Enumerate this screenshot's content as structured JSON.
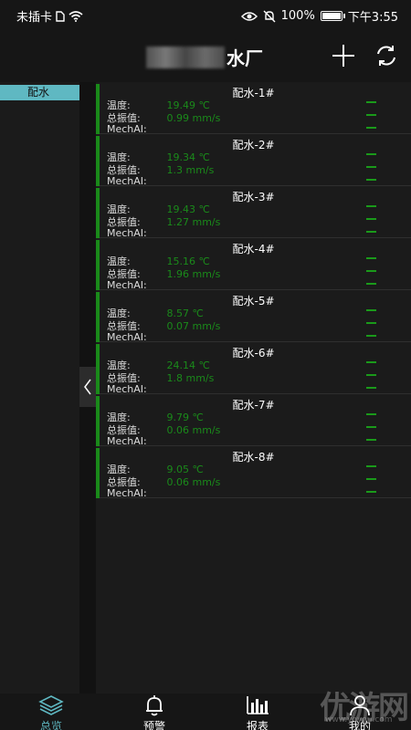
{
  "status_bar": {
    "carrier": "未插卡",
    "battery": "100%",
    "time": "下午3:55"
  },
  "header": {
    "title_suffix": "水厂"
  },
  "sidebar": {
    "items": [
      {
        "label": "配水"
      }
    ]
  },
  "labels": {
    "temp": "温度:",
    "vib": "总振值:",
    "mech": "MechAI:"
  },
  "devices": [
    {
      "name": "配水-1#",
      "temp": "19.49 ℃",
      "vib": "0.99 mm/s"
    },
    {
      "name": "配水-2#",
      "temp": "19.34 ℃",
      "vib": "1.3 mm/s"
    },
    {
      "name": "配水-3#",
      "temp": "19.43 ℃",
      "vib": "1.27 mm/s"
    },
    {
      "name": "配水-4#",
      "temp": "15.16 ℃",
      "vib": "1.96 mm/s"
    },
    {
      "name": "配水-5#",
      "temp": "8.57 ℃",
      "vib": "0.07 mm/s"
    },
    {
      "name": "配水-6#",
      "temp": "24.14 ℃",
      "vib": "1.8 mm/s"
    },
    {
      "name": "配水-7#",
      "temp": "9.79 ℃",
      "vib": "0.06 mm/s"
    },
    {
      "name": "配水-8#",
      "temp": "9.05 ℃",
      "vib": "0.06 mm/s"
    }
  ],
  "tabs": [
    {
      "label": "总览",
      "icon": "layers-icon",
      "active": true
    },
    {
      "label": "预警",
      "icon": "bell-icon",
      "active": false
    },
    {
      "label": "报表",
      "icon": "bar-chart-icon",
      "active": false
    },
    {
      "label": "我的",
      "icon": "user-icon",
      "active": false
    }
  ],
  "watermark": {
    "text": "优游网",
    "url": "www.yoyou.com"
  },
  "colors": {
    "accent": "#5fb8c2",
    "status_green": "#1a8a1a",
    "background": "#1b1b1b"
  }
}
